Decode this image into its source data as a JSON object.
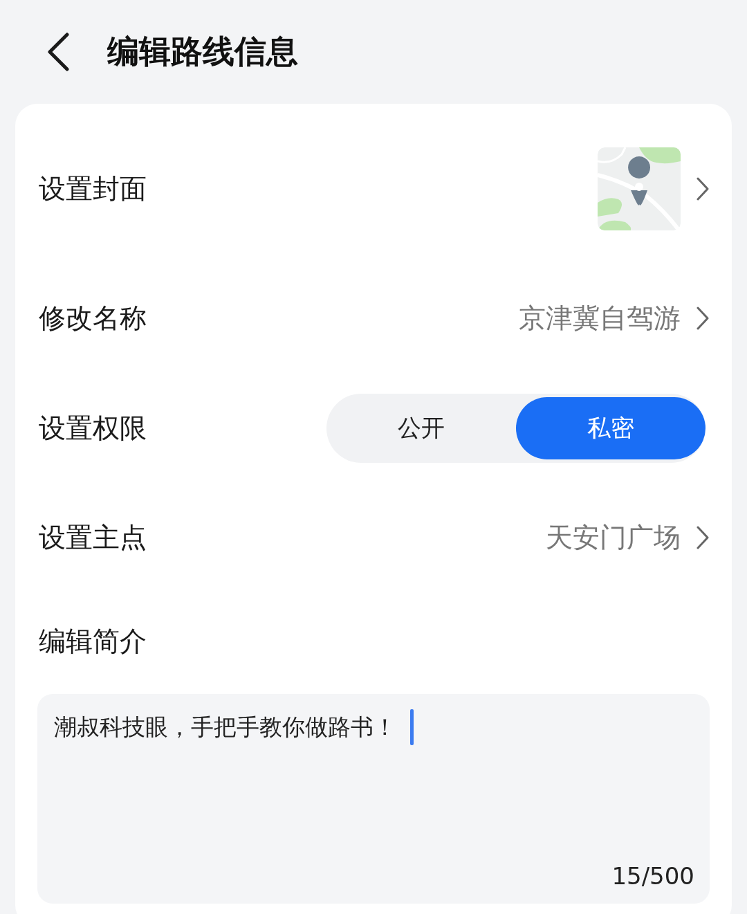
{
  "header": {
    "title": "编辑路线信息"
  },
  "rows": [
    {
      "kind": "cover",
      "label": "设置封面"
    },
    {
      "kind": "value",
      "label": "修改名称",
      "value": "京津冀自驾游"
    },
    {
      "kind": "segment",
      "label": "设置权限",
      "options": [
        {
          "label": "公开",
          "selected": false
        },
        {
          "label": "私密",
          "selected": true
        }
      ]
    },
    {
      "kind": "value",
      "label": "设置主点",
      "value": "天安门广场"
    }
  ],
  "intro": {
    "label": "编辑简介",
    "value": "潮叔科技眼，手把手教你做路书！",
    "counter": "15/500"
  }
}
